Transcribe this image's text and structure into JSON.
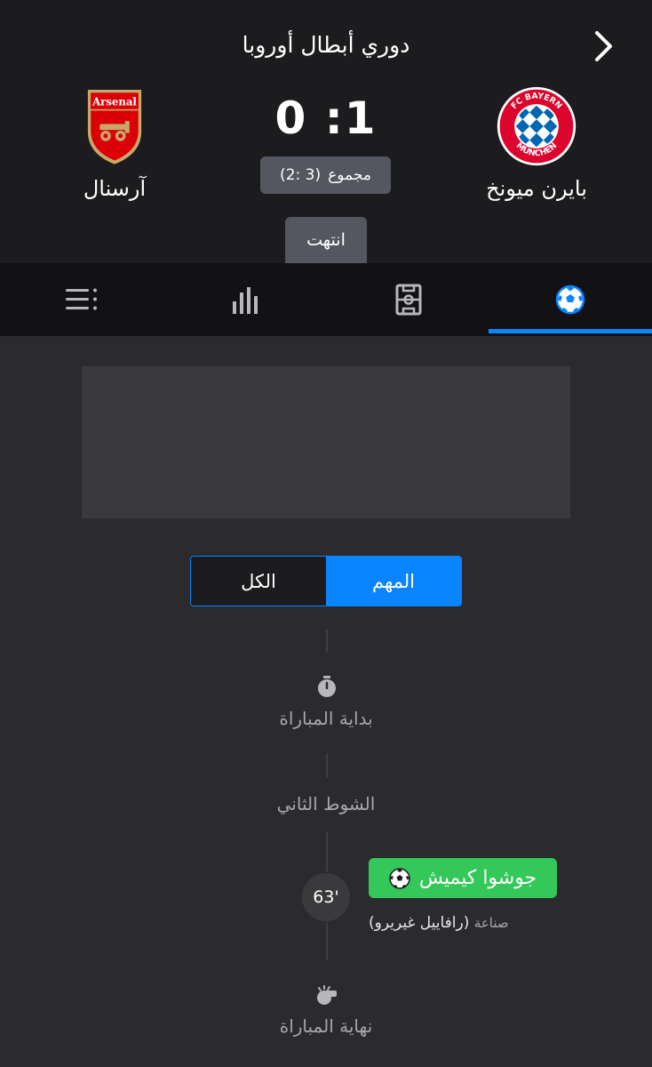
{
  "header": {
    "league_title": "دوري أبطال أوروبا",
    "back_icon": "chevron-right-icon",
    "home_team": {
      "name": "بايرن ميونخ",
      "logo_text_top": "FC BAYERN",
      "logo_text_bottom": "MÜNCHEN",
      "colors": {
        "primary": "#dc052d",
        "secondary": "#0066b2"
      }
    },
    "away_team": {
      "name": "آرسنال",
      "logo_text": "Arsenal",
      "colors": {
        "primary": "#db0007",
        "secondary": "#c6a96a"
      }
    },
    "score": "1: 0",
    "aggregate_label": "مجموع",
    "aggregate_value": "(3 :2)",
    "status": "انتهت"
  },
  "tabs": [
    {
      "icon": "soccer-ball-icon",
      "active": true
    },
    {
      "icon": "pitch-lineup-icon",
      "active": false
    },
    {
      "icon": "stats-bars-icon",
      "active": false
    },
    {
      "icon": "list-icon",
      "active": false
    }
  ],
  "filter": {
    "options": [
      "المهم",
      "الكل"
    ],
    "selected": "المهم"
  },
  "timeline": {
    "kickoff_label": "بداية المباراة",
    "second_half_label": "الشوط الثاني",
    "goal": {
      "minute": "63'",
      "scorer": "جوشوا كيميش",
      "assist_label": "صناعة",
      "assist_player": "(رافاييل غيريرو)"
    },
    "fulltime_label": "نهاية المباراة"
  },
  "colors": {
    "accent": "#0a84ff",
    "goal": "#34c759",
    "header_bg": "#1c1c1e",
    "body_bg": "#2b2b2d"
  }
}
